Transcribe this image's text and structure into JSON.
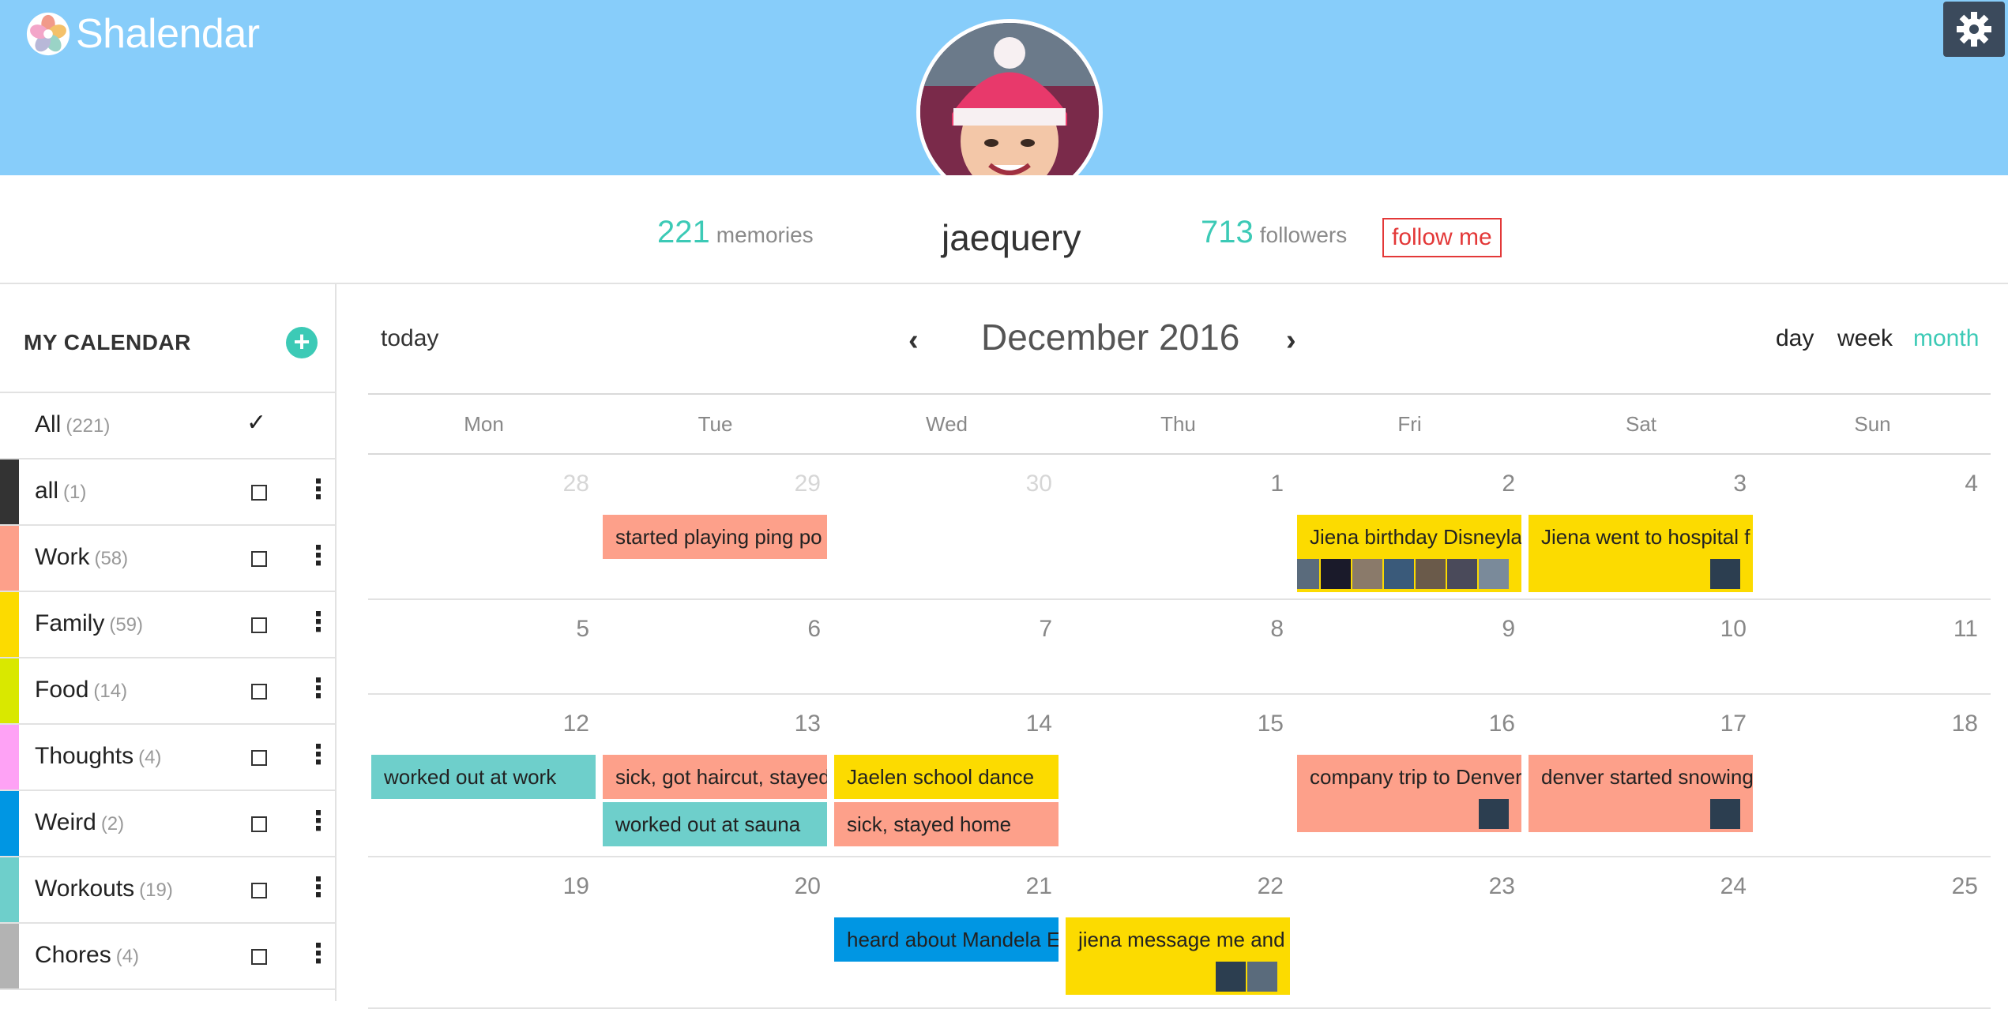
{
  "app": {
    "name": "Shalendar"
  },
  "profile": {
    "username": "jaequery",
    "memories_count": "221",
    "memories_label": "memories",
    "followers_count": "713",
    "followers_label": "followers",
    "follow_label": "follow me"
  },
  "sidebar": {
    "title": "MY CALENDAR",
    "add_label": "+",
    "categories": [
      {
        "name": "All",
        "count": "(221)",
        "checked": true
      },
      {
        "name": "all",
        "count": "(1)",
        "color": "#333333"
      },
      {
        "name": "Work",
        "count": "(58)",
        "color": "#fda08a"
      },
      {
        "name": "Family",
        "count": "(59)",
        "color": "#fcdb00"
      },
      {
        "name": "Food",
        "count": "(14)",
        "color": "#d9e800"
      },
      {
        "name": "Thoughts",
        "count": "(4)",
        "color": "#fea2f5"
      },
      {
        "name": "Weird",
        "count": "(2)",
        "color": "#0096e3"
      },
      {
        "name": "Workouts",
        "count": "(19)",
        "color": "#6ecfcb"
      },
      {
        "name": "Chores",
        "count": "(4)",
        "color": "#b3b3b3"
      }
    ]
  },
  "toolbar": {
    "today_label": "today",
    "month_title": "December 2016",
    "prev_label": "‹",
    "next_label": "›",
    "views": [
      "day",
      "week",
      "month"
    ],
    "active_view": "month"
  },
  "calendar": {
    "weekdays": [
      "Mon",
      "Tue",
      "Wed",
      "Thu",
      "Fri",
      "Sat",
      "Sun"
    ],
    "weeks": [
      {
        "days": [
          "28",
          "29",
          "30",
          "1",
          "2",
          "3",
          "4"
        ],
        "muted": [
          true,
          true,
          true,
          false,
          false,
          false,
          false
        ]
      },
      {
        "days": [
          "5",
          "6",
          "7",
          "8",
          "9",
          "10",
          "11"
        ]
      },
      {
        "days": [
          "12",
          "13",
          "14",
          "15",
          "16",
          "17",
          "18"
        ]
      },
      {
        "days": [
          "19",
          "20",
          "21",
          "22",
          "23",
          "24",
          "25"
        ]
      }
    ],
    "events": [
      {
        "week": 0,
        "day": 1,
        "slot": 0,
        "title": "started playing ping po",
        "color": "#fda08a"
      },
      {
        "week": 0,
        "day": 4,
        "slot": 0,
        "title": "Jiena birthday Disneyla",
        "color": "#fcdb00",
        "tall": true,
        "thumbs": 8
      },
      {
        "week": 0,
        "day": 5,
        "slot": 0,
        "title": "Jiena went to hospital f",
        "color": "#fcdb00",
        "tall": true,
        "thumbs": 1
      },
      {
        "week": 2,
        "day": 0,
        "slot": 0,
        "title": "worked out at work",
        "color": "#6ecfcb"
      },
      {
        "week": 2,
        "day": 1,
        "slot": 0,
        "title": "sick, got haircut, stayed",
        "color": "#fda08a"
      },
      {
        "week": 2,
        "day": 1,
        "slot": 1,
        "title": "worked out at sauna",
        "color": "#6ecfcb"
      },
      {
        "week": 2,
        "day": 2,
        "slot": 0,
        "title": "Jaelen school dance",
        "color": "#fcdb00"
      },
      {
        "week": 2,
        "day": 2,
        "slot": 1,
        "title": "sick, stayed home",
        "color": "#fda08a"
      },
      {
        "week": 2,
        "day": 4,
        "slot": 0,
        "title": "company trip to Denver",
        "color": "#fda08a",
        "tall": true,
        "thumbs": 1
      },
      {
        "week": 2,
        "day": 5,
        "slot": 0,
        "title": "denver started snowing",
        "color": "#fda08a",
        "tall": true,
        "thumbs": 1
      },
      {
        "week": 3,
        "day": 2,
        "slot": 0,
        "title": "heard about Mandela E",
        "color": "#0096e3"
      },
      {
        "week": 3,
        "day": 3,
        "slot": 0,
        "title": "jiena message me and c",
        "color": "#fcdb00",
        "tall": true,
        "thumbs": 2
      }
    ]
  }
}
